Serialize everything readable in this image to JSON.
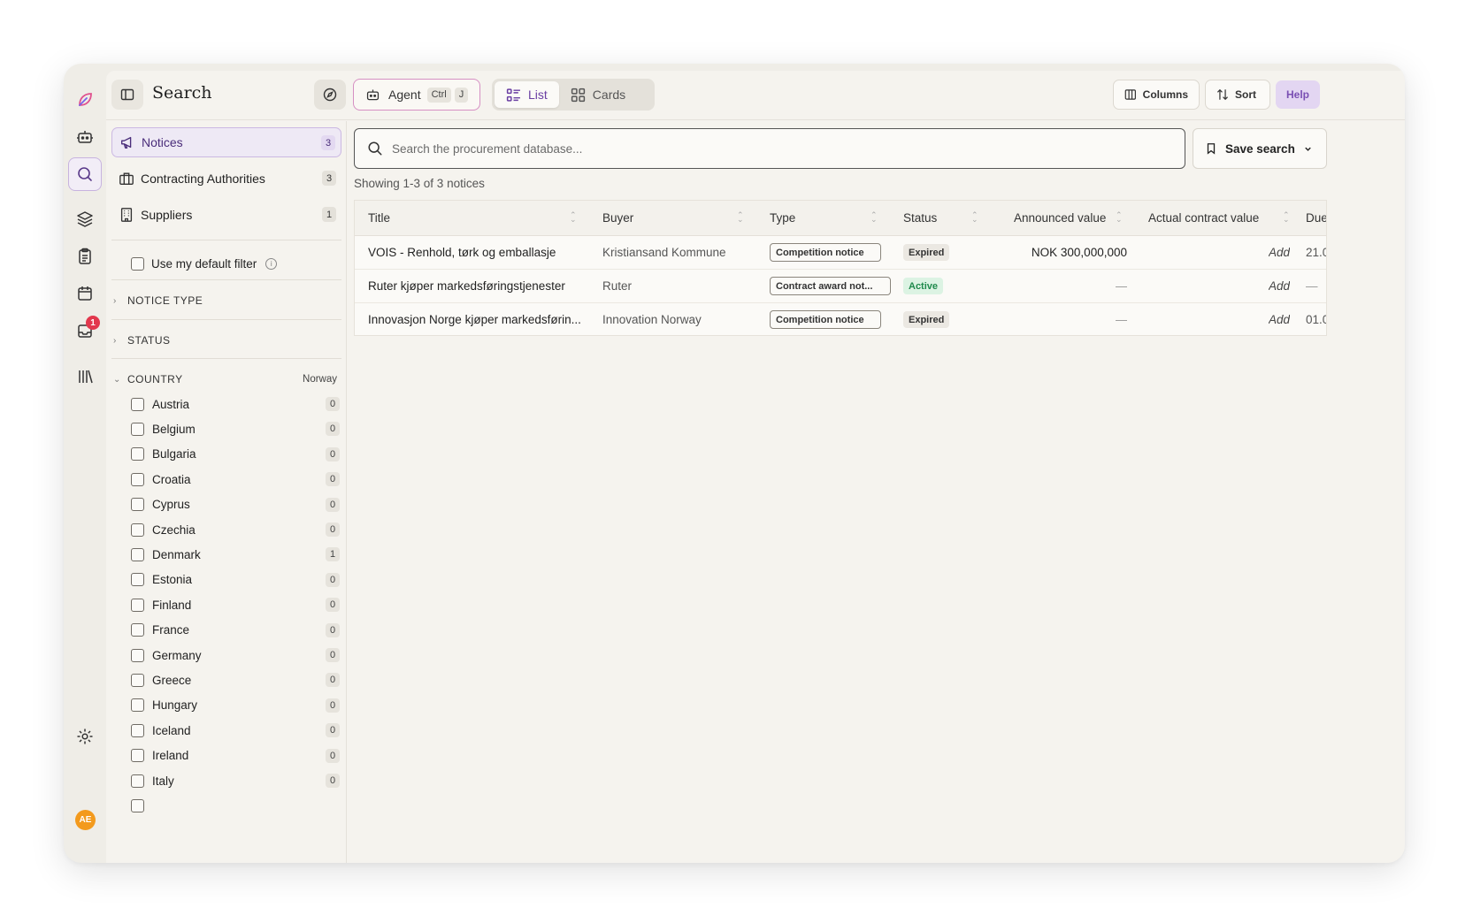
{
  "rail": {
    "icons": [
      "logo-icon",
      "robot-icon",
      "search-icon",
      "layers-icon",
      "clipboard-icon",
      "calendar-icon",
      "inbox-icon",
      "library-icon",
      "gear-icon"
    ],
    "notification_count": "1",
    "avatar_initials": "AE"
  },
  "header": {
    "title": "Search",
    "agent_label": "Agent",
    "agent_shortcut_1": "Ctrl",
    "agent_shortcut_2": "J",
    "view_list": "List",
    "view_cards": "Cards",
    "columns_label": "Columns",
    "sort_label": "Sort",
    "help_label": "Help"
  },
  "sidebar": {
    "nav": [
      {
        "label": "Notices",
        "count": "3"
      },
      {
        "label": "Contracting Authorities",
        "count": "3"
      },
      {
        "label": "Suppliers",
        "count": "1"
      }
    ],
    "default_filter_label": "Use my default filter",
    "sections": {
      "notice_type": "NOTICE TYPE",
      "status": "STATUS",
      "country": "COUNTRY",
      "country_value": "Norway"
    },
    "countries": [
      {
        "name": "Austria",
        "count": "0"
      },
      {
        "name": "Belgium",
        "count": "0"
      },
      {
        "name": "Bulgaria",
        "count": "0"
      },
      {
        "name": "Croatia",
        "count": "0"
      },
      {
        "name": "Cyprus",
        "count": "0"
      },
      {
        "name": "Czechia",
        "count": "0"
      },
      {
        "name": "Denmark",
        "count": "1"
      },
      {
        "name": "Estonia",
        "count": "0"
      },
      {
        "name": "Finland",
        "count": "0"
      },
      {
        "name": "France",
        "count": "0"
      },
      {
        "name": "Germany",
        "count": "0"
      },
      {
        "name": "Greece",
        "count": "0"
      },
      {
        "name": "Hungary",
        "count": "0"
      },
      {
        "name": "Iceland",
        "count": "0"
      },
      {
        "name": "Ireland",
        "count": "0"
      },
      {
        "name": "Italy",
        "count": "0"
      }
    ]
  },
  "content": {
    "search_placeholder": "Search the procurement database...",
    "save_search_label": "Save search",
    "showing_text": "Showing 1-3 of 3 notices",
    "columns": [
      "Title",
      "Buyer",
      "Type",
      "Status",
      "Announced value",
      "Actual contract value",
      "Due"
    ],
    "rows": [
      {
        "title": "VOIS - Renhold, tørk og emballasje",
        "buyer": "Kristiansand Kommune",
        "type": "Competition notice",
        "status": "Expired",
        "announced": "NOK 300,000,000",
        "actual": "Add",
        "due": "21.0"
      },
      {
        "title": "Ruter kjøper markedsføringstjenester",
        "buyer": "Ruter",
        "type": "Contract award not...",
        "status": "Active",
        "announced": "—",
        "actual": "Add",
        "due": "—"
      },
      {
        "title": "Innovasjon Norge kjøper markedsførin...",
        "buyer": "Innovation Norway",
        "type": "Competition notice",
        "status": "Expired",
        "announced": "—",
        "actual": "Add",
        "due": "01.0"
      }
    ]
  },
  "colors": {
    "accent": "#6a3fa3",
    "expired_bg": "#ebe8e2",
    "active_bg": "#dcf3e3",
    "active_fg": "#1f8a4c",
    "badge_red": "#e2384d"
  }
}
